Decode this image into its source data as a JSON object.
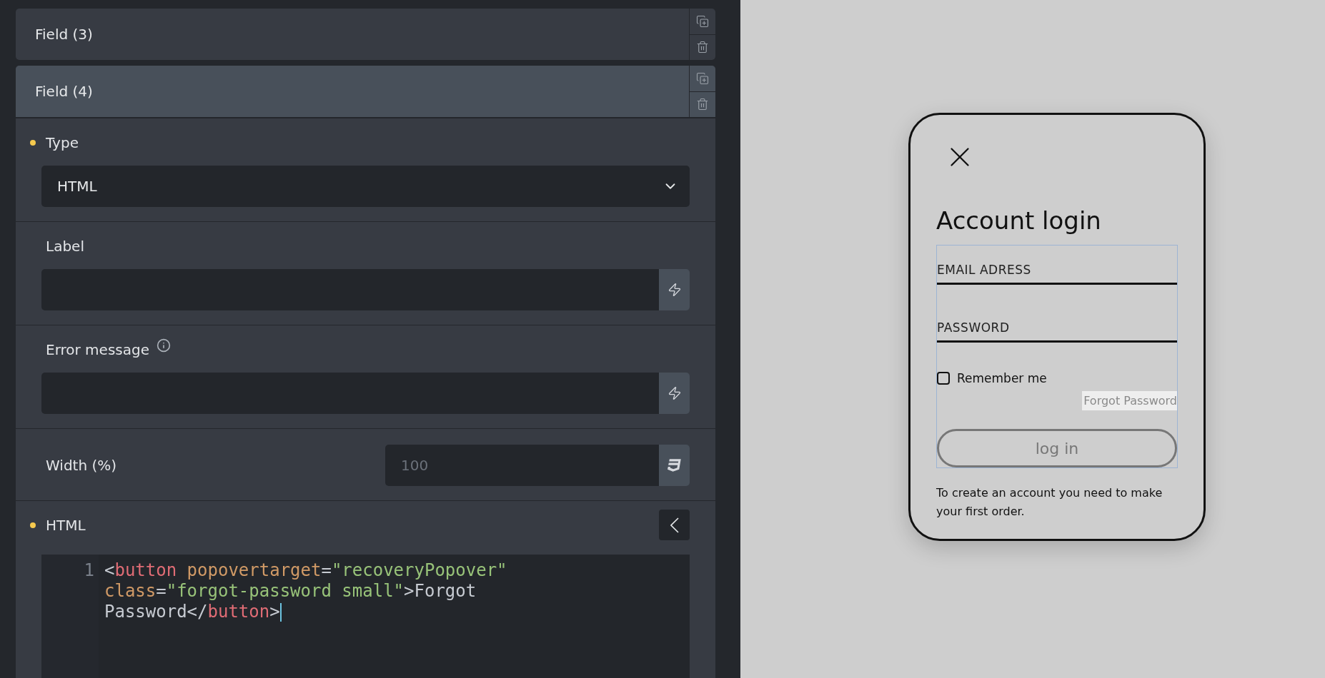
{
  "fields": [
    {
      "title": "Field (3)",
      "expanded": false
    },
    {
      "title": "Field (4)",
      "expanded": true
    }
  ],
  "settings": [
    {
      "kind": "select",
      "label": "Type",
      "required": true,
      "value": "HTML"
    },
    {
      "kind": "dynamic",
      "label": "Label",
      "required": false
    },
    {
      "kind": "dynamic",
      "label": "Error message",
      "required": false,
      "info": true
    },
    {
      "kind": "css",
      "label": "Width (%)",
      "required": false,
      "placeholder": "100"
    },
    {
      "kind": "code",
      "label": "HTML",
      "required": true,
      "line_number": "1",
      "code": [
        {
          "kind": "punct",
          "text": "<"
        },
        {
          "kind": "tag",
          "text": "button"
        },
        {
          "kind": "attr",
          "text": " popovertarget"
        },
        {
          "kind": "punct",
          "text": "="
        },
        {
          "kind": "string",
          "text": "\"recoveryPopover\""
        },
        {
          "kind": "attr",
          "text": " class"
        },
        {
          "kind": "punct",
          "text": "="
        },
        {
          "kind": "string",
          "text": "\"forgot-password small\""
        },
        {
          "kind": "punct",
          "text": ">"
        },
        {
          "kind": "plain",
          "text": "Forgot Password"
        },
        {
          "kind": "punct",
          "text": "</"
        },
        {
          "kind": "tag",
          "text": "button"
        },
        {
          "kind": "punct",
          "text": ">"
        }
      ]
    }
  ],
  "preview": {
    "title": "Account login",
    "inputs": [
      {
        "label": "EMAIL ADRESS"
      },
      {
        "label": "PASSWORD"
      }
    ],
    "remember": {
      "label": "Remember me",
      "checked": false
    },
    "forgot": "Forgot Password",
    "login": "log in",
    "note": "To create an account you need to make your first order."
  }
}
